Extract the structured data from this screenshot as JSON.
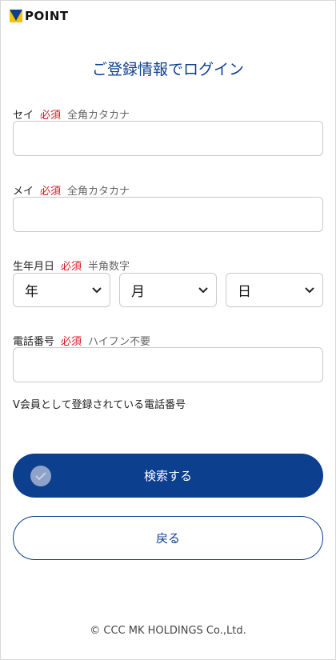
{
  "header": {
    "logo_text": "POINT",
    "logo_icon": "v-logo-icon",
    "brand_colors": [
      "#0d3f8f",
      "#f5c400"
    ]
  },
  "title": "ご登録情報でログイン",
  "fields": {
    "sei": {
      "label": "セイ",
      "required": "必須",
      "hint": "全角カタカナ",
      "value": ""
    },
    "mei": {
      "label": "メイ",
      "required": "必須",
      "hint": "全角カタカナ",
      "value": ""
    },
    "birth": {
      "label": "生年月日",
      "required": "必須",
      "hint": "半角数字",
      "year": "年",
      "month": "月",
      "day": "日"
    },
    "phone": {
      "label": "電話番号",
      "required": "必須",
      "hint": "ハイフン不要",
      "value": ""
    }
  },
  "phone_note": "V会員として登録されている電話番号",
  "buttons": {
    "search": "検索する",
    "back": "戻る"
  },
  "footer": "© CCC MK HOLDINGS Co.,Ltd.",
  "colors": {
    "primary": "#0d3f8f",
    "required": "#d6171f"
  }
}
